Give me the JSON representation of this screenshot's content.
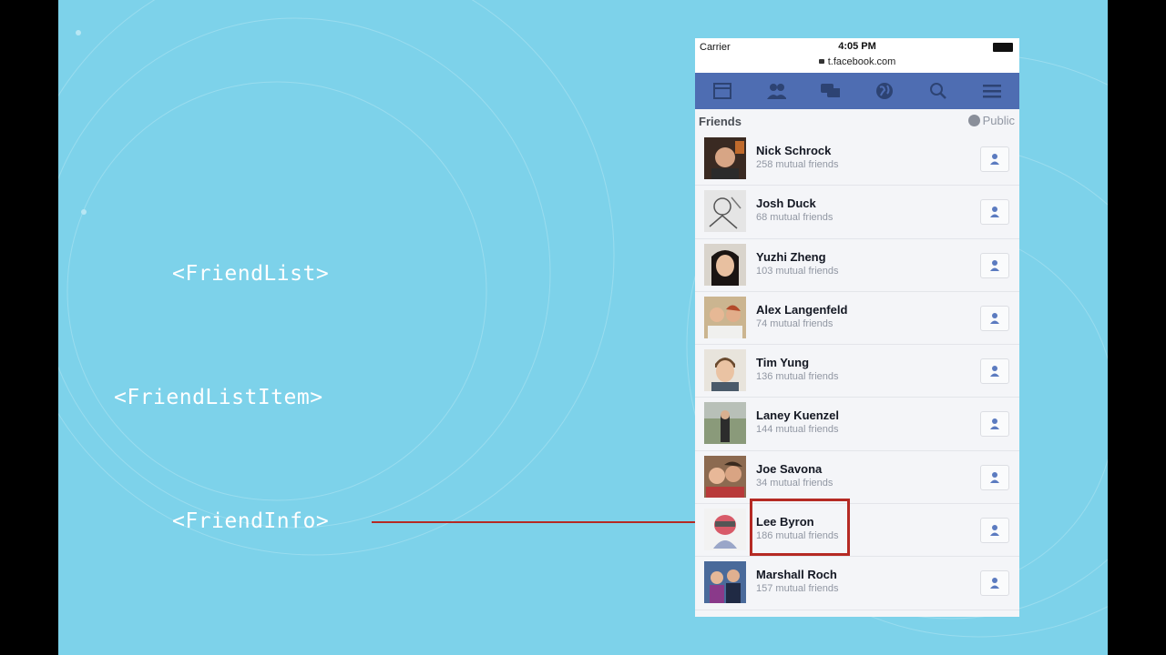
{
  "labels": {
    "friend_list": "<FriendList>",
    "friend_list_item": "<FriendListItem>",
    "friend_info": "<FriendInfo>"
  },
  "phone": {
    "status": {
      "carrier": "Carrier",
      "time": "4:05 PM",
      "url": "t.facebook.com"
    },
    "nav_icons": [
      "news-feed-icon",
      "friends-icon",
      "messages-icon",
      "globe-icon",
      "search-icon",
      "menu-icon"
    ],
    "section": {
      "title": "Friends",
      "privacy": "Public"
    },
    "friends": [
      {
        "name": "Nick Schrock",
        "mutual": "258 mutual friends"
      },
      {
        "name": "Josh Duck",
        "mutual": "68 mutual friends"
      },
      {
        "name": "Yuzhi Zheng",
        "mutual": "103 mutual friends"
      },
      {
        "name": "Alex Langenfeld",
        "mutual": "74 mutual friends"
      },
      {
        "name": "Tim Yung",
        "mutual": "136 mutual friends"
      },
      {
        "name": "Laney Kuenzel",
        "mutual": "144 mutual friends"
      },
      {
        "name": "Joe Savona",
        "mutual": "34 mutual friends"
      },
      {
        "name": "Lee Byron",
        "mutual": "186 mutual friends"
      },
      {
        "name": "Marshall Roch",
        "mutual": "157 mutual friends"
      }
    ]
  },
  "colors": {
    "background": "#7dd2ea",
    "nav_bar": "#4e6db2",
    "highlight": "#b52a24"
  }
}
